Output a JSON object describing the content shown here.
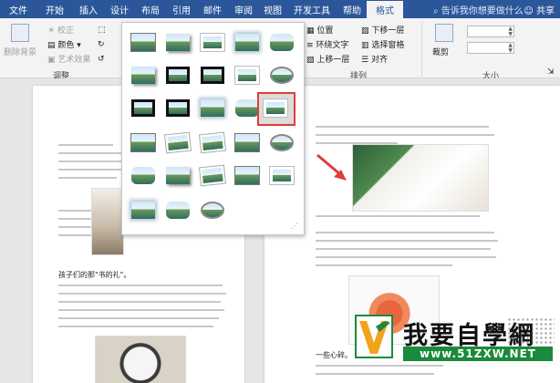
{
  "ribbon_tabs": [
    "文件",
    "开始",
    "插入",
    "设计",
    "布局",
    "引用",
    "邮件",
    "审阅",
    "视图",
    "开发工具",
    "帮助",
    "格式"
  ],
  "active_tab": "格式",
  "tell_me": "告诉我你想要做什么",
  "share": "共享",
  "ribbon": {
    "remove_bg": "删除背景",
    "corrections": "校正",
    "color": "颜色",
    "artistic": "艺术效果",
    "adjust_group": "调整",
    "position": "位置",
    "wrap_text": "环绕文字",
    "bring_forward": "上移一层",
    "send_backward": "下移一层",
    "selection_pane": "选择窗格",
    "align": "对齐",
    "arrange_group": "排列",
    "crop": "裁剪",
    "size_group": "大小"
  },
  "left_page_text": {
    "caption": "孩子们的那\"书的礼\"。"
  },
  "right_page_text": {
    "caption": "一些心碎。"
  },
  "watermark": {
    "title": "我要自學網",
    "url": "www.51ZXW.NET"
  },
  "icons": {
    "search": "search-icon",
    "share": "share-icon",
    "arrow": "red-arrow-icon"
  },
  "colors": {
    "ribbon_blue": "#2b579a",
    "highlight": "#e03c3c",
    "url_green": "#1a8a3c"
  }
}
